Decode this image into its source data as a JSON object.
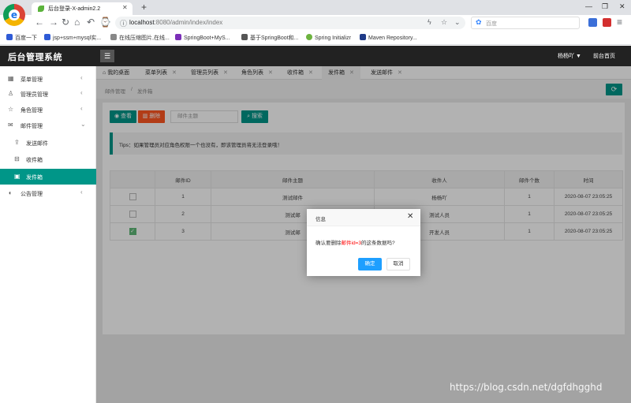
{
  "browser": {
    "tab_title": "后台登录-X-admin2.2",
    "tab_close": "✕",
    "new_tab": "+",
    "url_host": "localhost",
    "url_rest": ":8080/admin/index/index",
    "search_placeholder": "百度",
    "bookmarks": [
      "百度一下",
      "jsp+ssm+mysql实...",
      "在线压缩图片,在线...",
      "SpringBoot+MyS...",
      "基于SpringBoot和...",
      "Spring Initializr",
      "Maven Repository..."
    ]
  },
  "app": {
    "title": "后台管理系统",
    "user": "杨杨吖 ▼",
    "front_link": "前台首页"
  },
  "sidebar": {
    "items": [
      {
        "label": "菜单管理",
        "icon": "grid-icon",
        "arrow": "‹"
      },
      {
        "label": "管理员管理",
        "icon": "user-icon",
        "arrow": "‹"
      },
      {
        "label": "角色管理",
        "icon": "star-icon",
        "arrow": "‹"
      },
      {
        "label": "邮件管理",
        "icon": "mail-icon",
        "arrow": "⌄"
      },
      {
        "label": "发送邮件",
        "icon": "send-icon"
      },
      {
        "label": "收件箱",
        "icon": "inbox-icon"
      },
      {
        "label": "发件箱",
        "icon": "outbox-icon"
      },
      {
        "label": "公告管理",
        "icon": "speaker-icon",
        "arrow": "‹"
      }
    ]
  },
  "page_tabs": [
    {
      "label": "我的桌面"
    },
    {
      "label": "菜单列表"
    },
    {
      "label": "管理员列表"
    },
    {
      "label": "角色列表"
    },
    {
      "label": "收件箱"
    },
    {
      "label": "发件箱"
    },
    {
      "label": "发送邮件"
    }
  ],
  "breadcrumb": {
    "first": "邮件管理",
    "sep": "/",
    "second": "发件箱"
  },
  "toolbar": {
    "view_label": "查看",
    "delete_label": "删除",
    "subject_placeholder": "邮件主题",
    "search_label": "搜索"
  },
  "tips": "Tips：如果管理员对应角色权限一个也没有，即该管理员将无法登录哦！",
  "table": {
    "headers": [
      "",
      "邮件ID",
      "邮件主题",
      "收件人",
      "邮件个数",
      "时间"
    ],
    "rows": [
      {
        "checked": false,
        "id": "1",
        "subject": "测试邮件",
        "recipient": "杨杨吖",
        "count": "1",
        "time": "2020-08-07 23:05:25"
      },
      {
        "checked": false,
        "id": "2",
        "subject": "测试邮",
        "recipient": "测试人员",
        "count": "1",
        "time": "2020-08-07 23:05:25"
      },
      {
        "checked": true,
        "id": "3",
        "subject": "测试邮",
        "recipient": "开发人员",
        "count": "1",
        "time": "2020-08-07 23:05:25"
      }
    ]
  },
  "dialog": {
    "title": "信息",
    "msg_prefix": "确认要删除",
    "msg_highlight": "邮件id=3",
    "msg_suffix": "的这条数据吗?",
    "ok_label": "确定",
    "cancel_label": "取消"
  },
  "watermark": "https://blog.csdn.net/dgfdhgghd",
  "colors": {
    "primary": "#009688",
    "danger": "#ff5722",
    "dialog_ok": "#1e9fff",
    "header": "#222222"
  }
}
